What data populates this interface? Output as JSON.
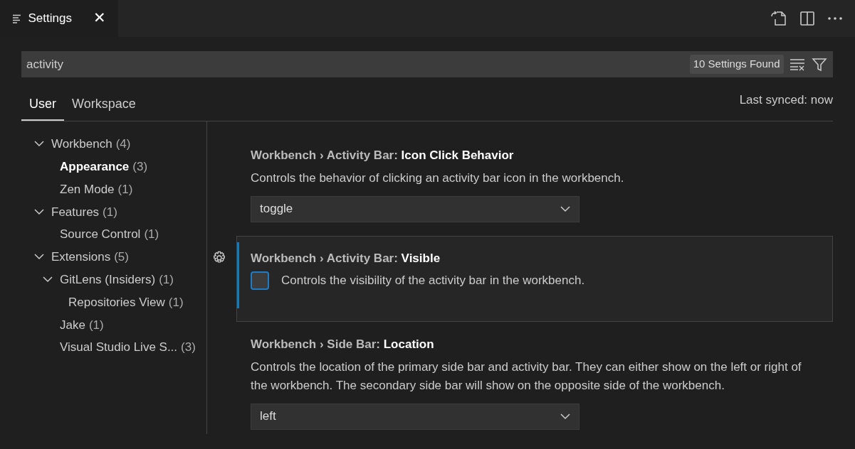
{
  "editor_tab": {
    "title": "Settings",
    "close": "✕"
  },
  "search": {
    "value": "activity",
    "result_count": "10 Settings Found"
  },
  "scope_tabs": [
    {
      "label": "User",
      "selected": true
    },
    {
      "label": "Workspace",
      "selected": false
    }
  ],
  "sync_status": "Last synced: now",
  "tree": [
    {
      "label": "Workbench",
      "count": "(4)",
      "expanded": true,
      "selected": false,
      "children": [
        {
          "label": "Appearance",
          "count": "(3)",
          "selected": true
        },
        {
          "label": "Zen Mode",
          "count": "(1)",
          "selected": false
        }
      ]
    },
    {
      "label": "Features",
      "count": "(1)",
      "expanded": true,
      "selected": false,
      "children": [
        {
          "label": "Source Control",
          "count": "(1)",
          "selected": false
        }
      ]
    },
    {
      "label": "Extensions",
      "count": "(5)",
      "expanded": true,
      "selected": false,
      "children": [
        {
          "label": "GitLens (Insiders)",
          "count": "(1)",
          "expanded": true,
          "selected": false,
          "children": [
            {
              "label": "Repositories View",
              "count": "(1)",
              "selected": false
            }
          ]
        },
        {
          "label": "Jake",
          "count": "(1)",
          "selected": false
        },
        {
          "label": "Visual Studio Live S...",
          "count": "(3)",
          "selected": false
        }
      ]
    }
  ],
  "settings": [
    {
      "kind": "dropdown",
      "category": "Workbench › Activity Bar: ",
      "name": "Icon Click Behavior",
      "description": "Controls the behavior of clicking an activity bar icon in the workbench.",
      "value": "toggle",
      "focused": false
    },
    {
      "kind": "checkbox",
      "category": "Workbench › Activity Bar: ",
      "name": "Visible",
      "description": "Controls the visibility of the activity bar in the workbench.",
      "checked": false,
      "focused": true
    },
    {
      "kind": "dropdown",
      "category": "Workbench › Side Bar: ",
      "name": "Location",
      "description": "Controls the location of the primary side bar and activity bar. They can either show on the left or right of the workbench. The secondary side bar will show on the opposite side of the workbench.",
      "value": "left",
      "focused": false
    }
  ]
}
